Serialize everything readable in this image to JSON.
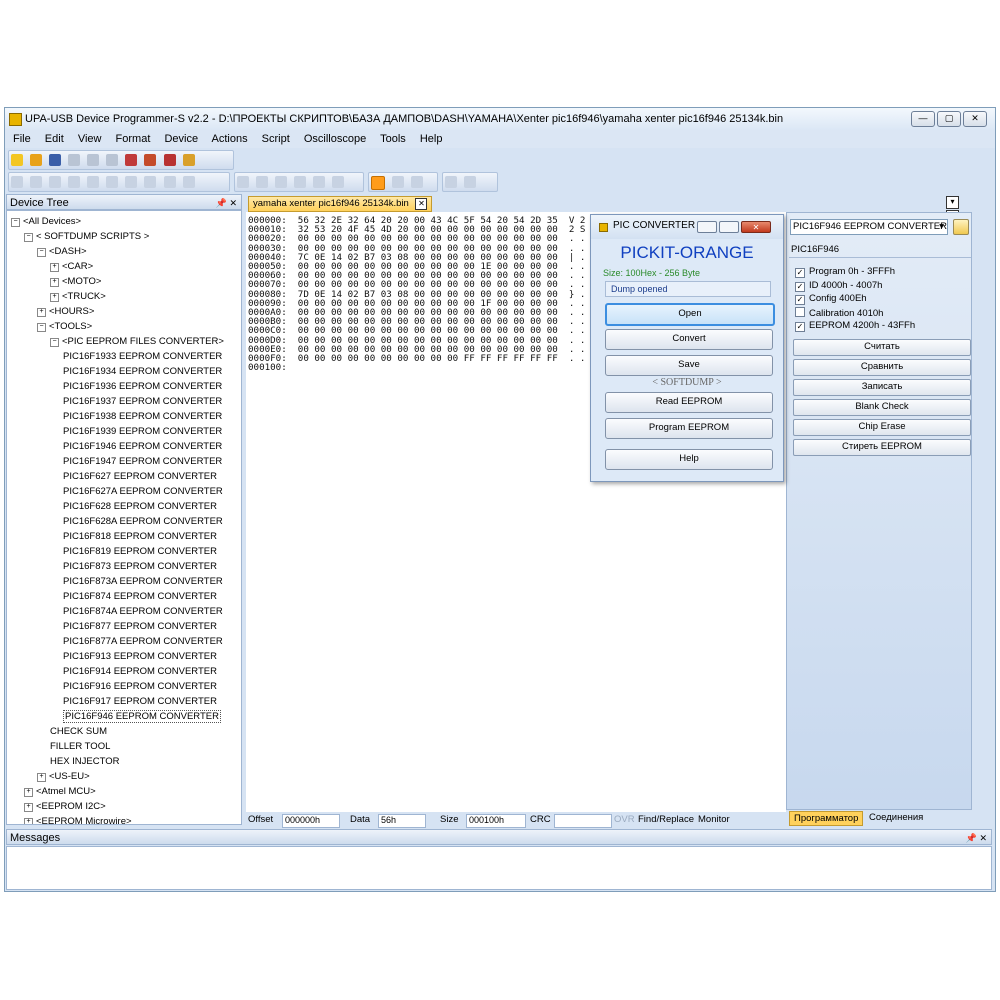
{
  "window": {
    "title": "UPA-USB Device Programmer-S v2.2 - D:\\ПРОЕКТЫ СКРИПТОВ\\БАЗА ДАМПОВ\\DASH\\YAMAHA\\Xenter pic16f946\\yamaha xenter pic16f946 25134k.bin",
    "min_label": "—",
    "max_label": "▢",
    "close_label": "✕"
  },
  "menu": [
    "File",
    "Edit",
    "View",
    "Format",
    "Device",
    "Actions",
    "Script",
    "Oscilloscope",
    "Tools",
    "Help"
  ],
  "device_tree": {
    "header": "Device Tree",
    "pin_label": "📌 ✕",
    "items": [
      {
        "label": "<All Devices>",
        "indent": 0,
        "exp": "−"
      },
      {
        "label": "< SOFTDUMP SCRIPTS >",
        "indent": 1,
        "exp": "−"
      },
      {
        "label": "<DASH>",
        "indent": 2,
        "exp": "−"
      },
      {
        "label": "<CAR>",
        "indent": 3,
        "exp": "+"
      },
      {
        "label": "<MOTO>",
        "indent": 3,
        "exp": "+"
      },
      {
        "label": "<TRUCK>",
        "indent": 3,
        "exp": "+"
      },
      {
        "label": "<HOURS>",
        "indent": 2,
        "exp": "+"
      },
      {
        "label": "<TOOLS>",
        "indent": 2,
        "exp": "−"
      },
      {
        "label": "<PIC EEPROM FILES CONVERTER>",
        "indent": 3,
        "exp": "−"
      },
      {
        "label": "PIC16F1933 EEPROM CONVERTER",
        "indent": 4,
        "exp": ""
      },
      {
        "label": "PIC16F1934 EEPROM CONVERTER",
        "indent": 4,
        "exp": ""
      },
      {
        "label": "PIC16F1936 EEPROM CONVERTER",
        "indent": 4,
        "exp": ""
      },
      {
        "label": "PIC16F1937 EEPROM CONVERTER",
        "indent": 4,
        "exp": ""
      },
      {
        "label": "PIC16F1938 EEPROM CONVERTER",
        "indent": 4,
        "exp": ""
      },
      {
        "label": "PIC16F1939 EEPROM CONVERTER",
        "indent": 4,
        "exp": ""
      },
      {
        "label": "PIC16F1946 EEPROM CONVERTER",
        "indent": 4,
        "exp": ""
      },
      {
        "label": "PIC16F1947 EEPROM CONVERTER",
        "indent": 4,
        "exp": ""
      },
      {
        "label": "PIC16F627 EEPROM CONVERTER",
        "indent": 4,
        "exp": ""
      },
      {
        "label": "PIC16F627A EEPROM CONVERTER",
        "indent": 4,
        "exp": ""
      },
      {
        "label": "PIC16F628 EEPROM CONVERTER",
        "indent": 4,
        "exp": ""
      },
      {
        "label": "PIC16F628A EEPROM CONVERTER",
        "indent": 4,
        "exp": ""
      },
      {
        "label": "PIC16F818 EEPROM CONVERTER",
        "indent": 4,
        "exp": ""
      },
      {
        "label": "PIC16F819 EEPROM CONVERTER",
        "indent": 4,
        "exp": ""
      },
      {
        "label": "PIC16F873 EEPROM CONVERTER",
        "indent": 4,
        "exp": ""
      },
      {
        "label": "PIC16F873A EEPROM CONVERTER",
        "indent": 4,
        "exp": ""
      },
      {
        "label": "PIC16F874 EEPROM CONVERTER",
        "indent": 4,
        "exp": ""
      },
      {
        "label": "PIC16F874A EEPROM CONVERTER",
        "indent": 4,
        "exp": ""
      },
      {
        "label": "PIC16F877 EEPROM CONVERTER",
        "indent": 4,
        "exp": ""
      },
      {
        "label": "PIC16F877A EEPROM CONVERTER",
        "indent": 4,
        "exp": ""
      },
      {
        "label": "PIC16F913 EEPROM CONVERTER",
        "indent": 4,
        "exp": ""
      },
      {
        "label": "PIC16F914 EEPROM CONVERTER",
        "indent": 4,
        "exp": ""
      },
      {
        "label": "PIC16F916 EEPROM CONVERTER",
        "indent": 4,
        "exp": ""
      },
      {
        "label": "PIC16F917 EEPROM CONVERTER",
        "indent": 4,
        "exp": ""
      },
      {
        "label": "PIC16F946 EEPROM CONVERTER",
        "indent": 4,
        "exp": "",
        "selected": true
      },
      {
        "label": "CHECK SUM",
        "indent": 3,
        "exp": ""
      },
      {
        "label": "FILLER TOOL",
        "indent": 3,
        "exp": ""
      },
      {
        "label": "HEX INJECTOR",
        "indent": 3,
        "exp": ""
      },
      {
        "label": "<US-EU>",
        "indent": 2,
        "exp": "+"
      },
      {
        "label": "<Atmel MCU>",
        "indent": 1,
        "exp": "+"
      },
      {
        "label": "<EEPROM I2C>",
        "indent": 1,
        "exp": "+"
      },
      {
        "label": "<EEPROM Microwire>",
        "indent": 1,
        "exp": "+"
      }
    ]
  },
  "document_tab": {
    "label": "yamaha xenter pic16f946 25134k.bin",
    "close": "✕"
  },
  "hex_lines": [
    "000000:  56 32 2E 32 64 20 20 00 43 4C 5F 54 20 54 2D 35  V 2 . 2 d",
    "000010:  32 53 20 4F 45 4D 20 00 00 00 00 00 00 00 00 00  2 S   O E M",
    "000020:  00 00 00 00 00 00 00 00 00 00 00 00 00 00 00 00  . . . . . .",
    "000030:  00 00 00 00 00 00 00 00 00 00 00 00 00 00 00 00  . . . . . .",
    "000040:  7C 0E 14 02 B7 03 08 00 00 00 00 00 00 00 00 00  | . . . . .",
    "000050:  00 00 00 00 00 00 00 00 00 00 00 1E 00 00 00 00  . . . . . .",
    "000060:  00 00 00 00 00 00 00 00 00 00 00 00 00 00 00 00  . . . . . .",
    "000070:  00 00 00 00 00 00 00 00 00 00 00 00 00 00 00 00  . . . . . .",
    "000080:  7D 0E 14 02 B7 03 08 00 00 00 00 00 00 00 00 00  } . . . . .",
    "000090:  00 00 00 00 00 00 00 00 00 00 00 1F 00 00 00 00  . . . . . .",
    "0000A0:  00 00 00 00 00 00 00 00 00 00 00 00 00 00 00 00  . . . . . .",
    "0000B0:  00 00 00 00 00 00 00 00 00 00 00 00 00 00 00 00  . . . . . .",
    "0000C0:  00 00 00 00 00 00 00 00 00 00 00 00 00 00 00 00  . . . . . .",
    "0000D0:  00 00 00 00 00 00 00 00 00 00 00 00 00 00 00 00  . . . . . .",
    "0000E0:  00 00 00 00 00 00 00 00 00 00 00 00 00 00 00 00  . . . . . .",
    "0000F0:  00 00 00 00 00 00 00 00 00 00 FF FF FF FF FF FF  . . . . . .",
    "000100:"
  ],
  "statusbar": {
    "offset_label": "Offset",
    "offset_value": "000000h",
    "data_label": "Data",
    "data_value": "56h",
    "size_label": "Size",
    "size_value": "000100h",
    "crc_label": "CRC",
    "crc_value": "",
    "ovr_label": "OVR",
    "find_label": "Find/Replace",
    "monitor_label": "Monitor"
  },
  "converter_dialog": {
    "title": "PIC CONVERTER",
    "heading": "PICKIT-ORANGE",
    "size_text": "Size: 100Hex - 256 Byte",
    "status_text": "Dump opened",
    "open_label": "Open",
    "convert_label": "Convert",
    "save_label": "Save",
    "softdump_label": "< SOFTDUMP >",
    "read_label": "Read EEPROM",
    "program_label": "Program EEPROM",
    "help_label": "Help"
  },
  "right_panel": {
    "close_label": "▾✕",
    "device_select": "PIC16F946 EEPROM CONVERTER",
    "device_name": "PIC16F946",
    "checkboxes": [
      {
        "label": "Program 0h - 3FFFh",
        "checked": true
      },
      {
        "label": "ID 4000h - 4007h",
        "checked": true
      },
      {
        "label": "Config 400Eh",
        "checked": true
      },
      {
        "label": "Calibration 4010h",
        "checked": false
      },
      {
        "label": "EEPROM 4200h - 43FFh",
        "checked": true
      }
    ],
    "buttons": [
      "Считать",
      "Сравнить",
      "Записать",
      "Blank Check",
      "Chip Erase",
      "Стиреть EEPROM"
    ],
    "tab_programmer": "Программатор",
    "tab_connections": "Соединения"
  },
  "messages": {
    "header": "Messages",
    "pin_label": "📌 ✕"
  },
  "colors": {
    "accent": "#ff8c00",
    "heading_blue": "#1040c0",
    "size_green": "#2a8a2a",
    "status_blue": "#1b3c8c"
  }
}
